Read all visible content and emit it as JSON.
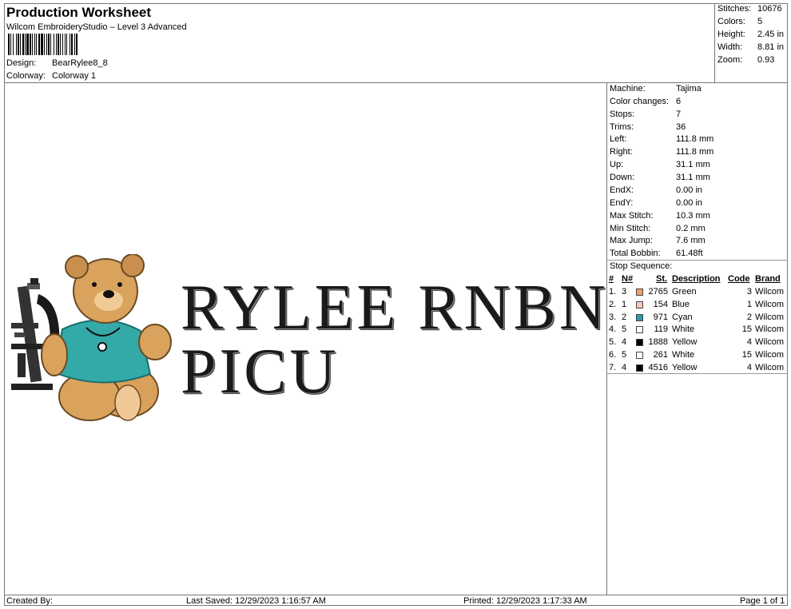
{
  "header": {
    "title": "Production Worksheet",
    "subtitle": "Wilcom EmbroideryStudio – Level 3 Advanced",
    "design_label": "Design:",
    "design_value": "BearRylee8_8",
    "colorway_label": "Colorway:",
    "colorway_value": "Colorway 1"
  },
  "stats": [
    {
      "label": "Stitches:",
      "value": "10676"
    },
    {
      "label": "Colors:",
      "value": "5"
    },
    {
      "label": "Height:",
      "value": "2.45 in"
    },
    {
      "label": "Width:",
      "value": "8.81 in"
    },
    {
      "label": "Zoom:",
      "value": "0.93"
    }
  ],
  "machine_info": [
    {
      "label": "Machine:",
      "value": "Tajima"
    },
    {
      "label": "Color changes:",
      "value": "6"
    },
    {
      "label": "Stops:",
      "value": "7"
    },
    {
      "label": "Trims:",
      "value": "36"
    },
    {
      "label": "Left:",
      "value": "111.8 mm"
    },
    {
      "label": "Right:",
      "value": "111.8 mm"
    },
    {
      "label": "Up:",
      "value": "31.1 mm"
    },
    {
      "label": "Down:",
      "value": "31.1 mm"
    },
    {
      "label": "EndX:",
      "value": "0.00 in"
    },
    {
      "label": "EndY:",
      "value": "0.00 in"
    },
    {
      "label": "Max Stitch:",
      "value": "10.3 mm"
    },
    {
      "label": "Min Stitch:",
      "value": "0.2 mm"
    },
    {
      "label": "Max Jump:",
      "value": "7.6 mm"
    },
    {
      "label": "Total Bobbin:",
      "value": "61.48ft"
    }
  ],
  "stop_sequence": {
    "title": "Stop Sequence:",
    "headers": {
      "num": "#",
      "n": "N#",
      "st": "St.",
      "desc": "Description",
      "code": "Code",
      "brand": "Brand"
    },
    "rows": [
      {
        "num": "1.",
        "n": "3",
        "color": "#f0a070",
        "st": "2765",
        "desc": "Green",
        "code": "3",
        "brand": "Wilcom"
      },
      {
        "num": "2.",
        "n": "1",
        "color": "#f7c9b8",
        "st": "154",
        "desc": "Blue",
        "code": "1",
        "brand": "Wilcom"
      },
      {
        "num": "3.",
        "n": "2",
        "color": "#2a9aa8",
        "st": "971",
        "desc": "Cyan",
        "code": "2",
        "brand": "Wilcom"
      },
      {
        "num": "4.",
        "n": "5",
        "color": "#ffffff",
        "st": "119",
        "desc": "White",
        "code": "15",
        "brand": "Wilcom"
      },
      {
        "num": "5.",
        "n": "4",
        "color": "#000000",
        "st": "1888",
        "desc": "Yellow",
        "code": "4",
        "brand": "Wilcom"
      },
      {
        "num": "6.",
        "n": "5",
        "color": "#ffffff",
        "st": "261",
        "desc": "White",
        "code": "15",
        "brand": "Wilcom"
      },
      {
        "num": "7.",
        "n": "4",
        "color": "#000000",
        "st": "4516",
        "desc": "Yellow",
        "code": "4",
        "brand": "Wilcom"
      }
    ]
  },
  "design": {
    "line1": "RYLEE RNBN",
    "line2": "PICU"
  },
  "footer": {
    "created_by": "Created By:",
    "last_saved": "Last Saved: 12/29/2023 1:16:57 AM",
    "printed": "Printed: 12/29/2023 1:17:33 AM",
    "page": "Page 1 of 1"
  }
}
